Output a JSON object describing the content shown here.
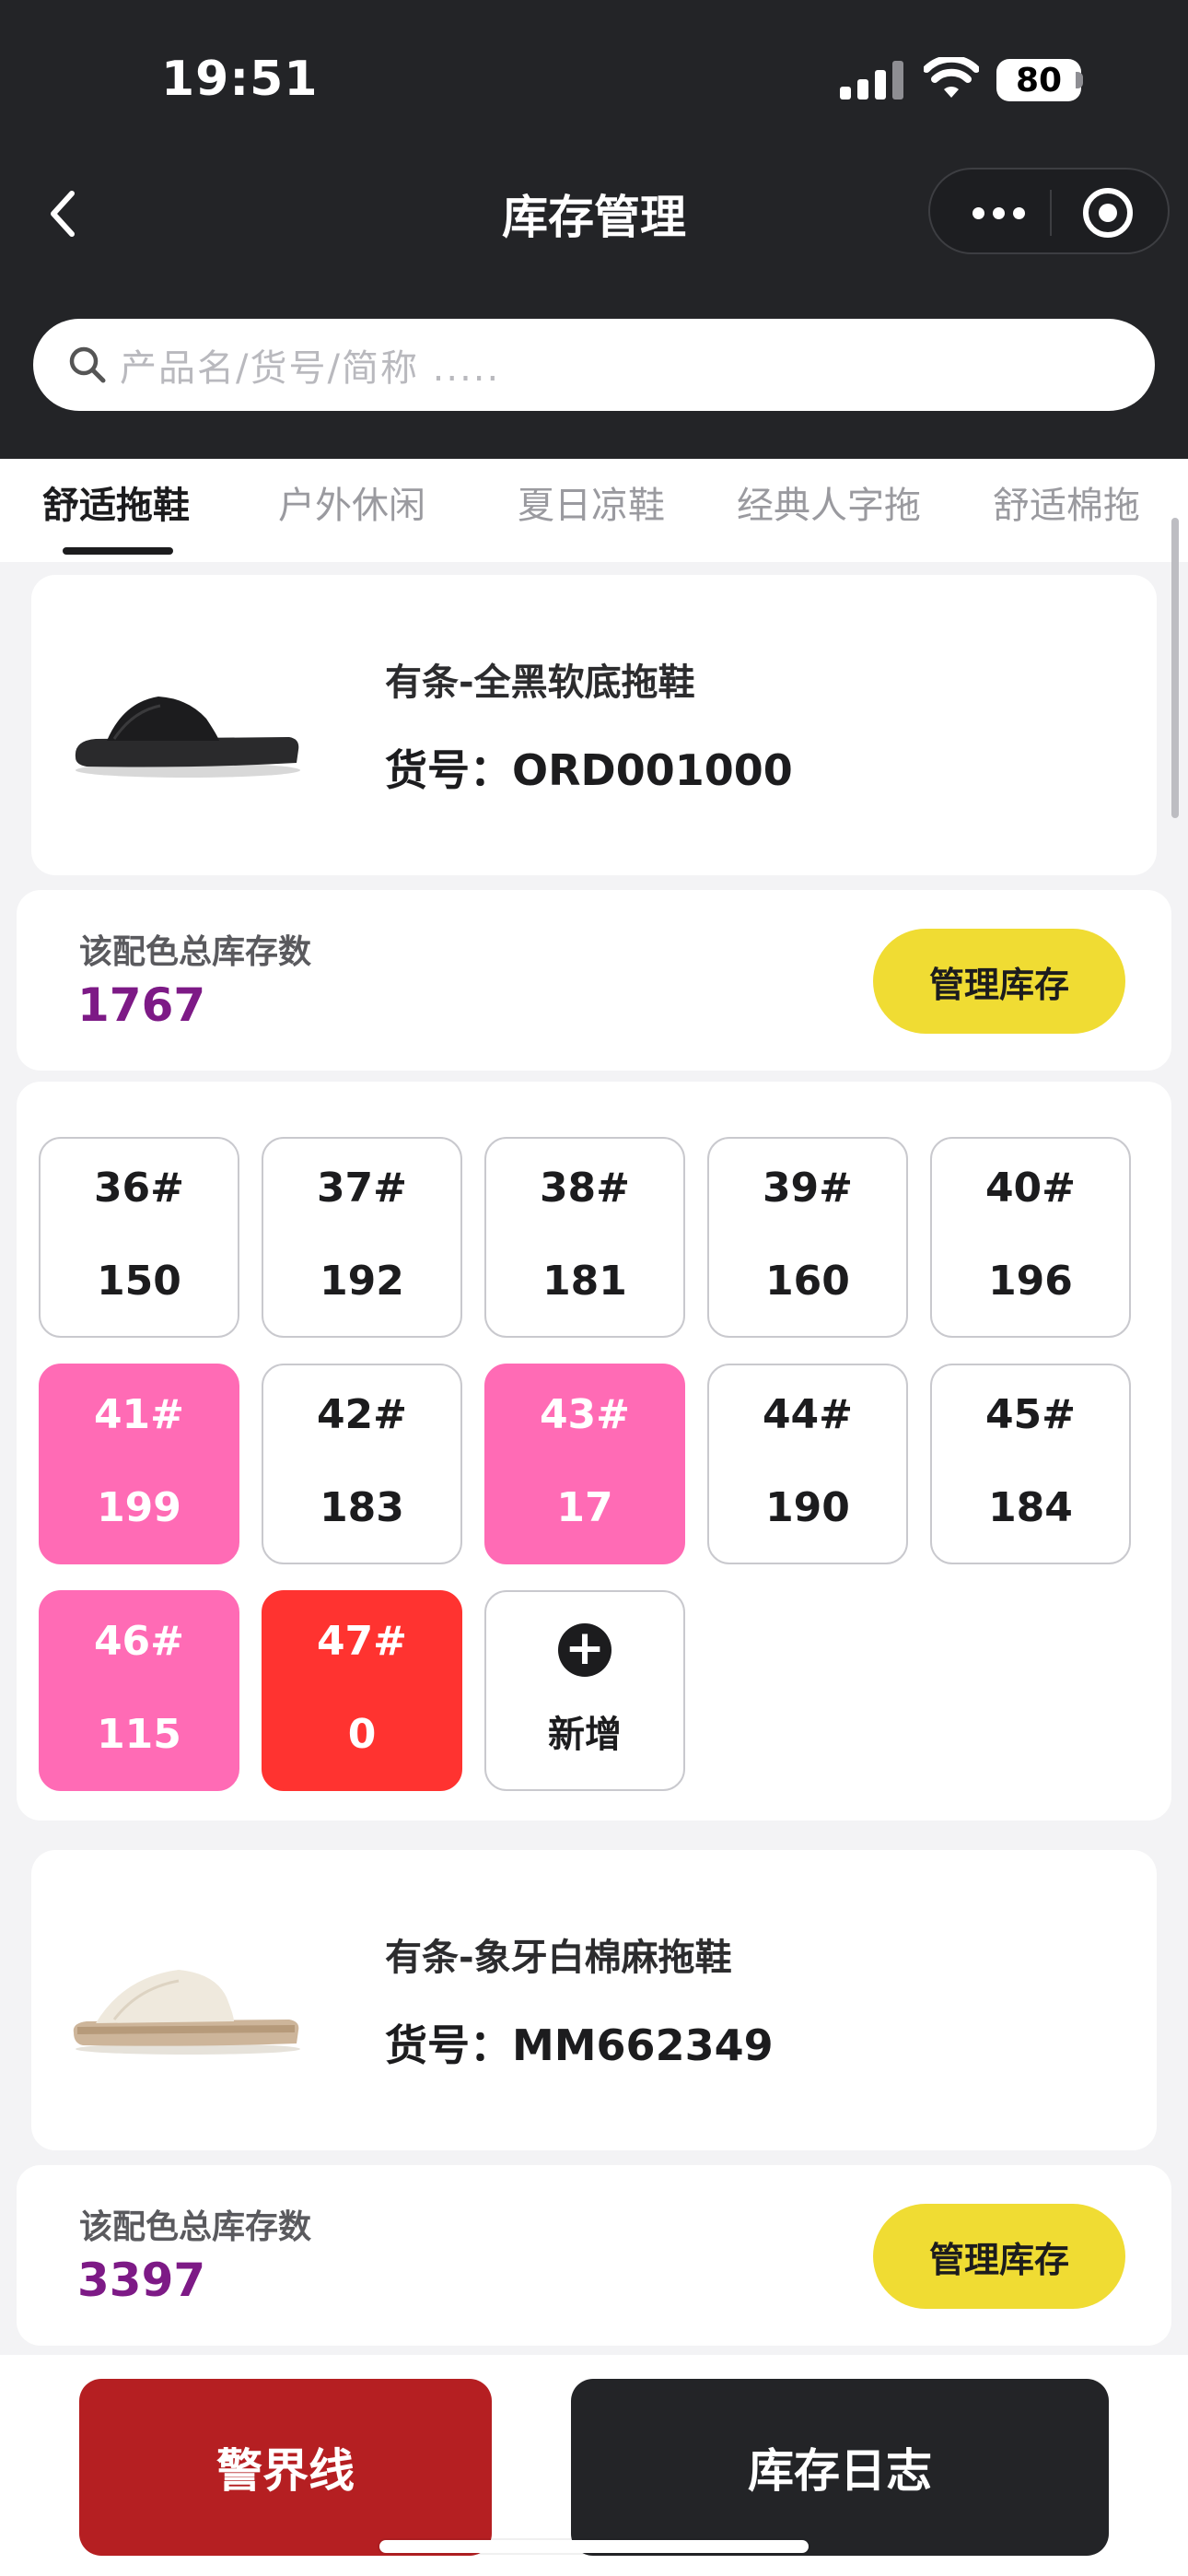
{
  "status_bar": {
    "time": "19:51",
    "battery": "80"
  },
  "nav": {
    "title": "库存管理"
  },
  "search": {
    "placeholder": "产品名/货号/简称 ....."
  },
  "tabs": [
    {
      "label": "舒适拖鞋",
      "active": true
    },
    {
      "label": "户外休闲",
      "active": false
    },
    {
      "label": "夏日凉鞋",
      "active": false
    },
    {
      "label": "经典人字拖",
      "active": false
    },
    {
      "label": "舒适棉拖",
      "active": false
    }
  ],
  "products": [
    {
      "name": "有条-全黑软底拖鞋",
      "code_label": "货号：",
      "code": "ORD001000",
      "code_full": "货号：ORD001000",
      "stock_label": "该配色总库存数",
      "stock_total": "1767",
      "manage_label": "管理库存",
      "image": "black-slipper",
      "sizes": [
        {
          "size": "36#",
          "qty": "150",
          "status": "normal"
        },
        {
          "size": "37#",
          "qty": "192",
          "status": "normal"
        },
        {
          "size": "38#",
          "qty": "181",
          "status": "normal"
        },
        {
          "size": "39#",
          "qty": "160",
          "status": "normal"
        },
        {
          "size": "40#",
          "qty": "196",
          "status": "normal"
        },
        {
          "size": "41#",
          "qty": "199",
          "status": "pink"
        },
        {
          "size": "42#",
          "qty": "183",
          "status": "normal"
        },
        {
          "size": "43#",
          "qty": "17",
          "status": "pink"
        },
        {
          "size": "44#",
          "qty": "190",
          "status": "normal"
        },
        {
          "size": "45#",
          "qty": "184",
          "status": "normal"
        },
        {
          "size": "46#",
          "qty": "115",
          "status": "pink"
        },
        {
          "size": "47#",
          "qty": "0",
          "status": "red"
        }
      ],
      "add_label": "新增"
    },
    {
      "name": "有条-象牙白棉麻拖鞋",
      "code_full": "货号：MM662349",
      "stock_label": "该配色总库存数",
      "stock_total": "3397",
      "manage_label": "管理库存",
      "image": "ivory-slipper"
    }
  ],
  "bottom": {
    "warn_label": "警界线",
    "log_label": "库存日志"
  },
  "colors": {
    "header_bg": "#232427",
    "accent_yellow": "#f0dc33",
    "stock_purple": "#7d1a86",
    "warn_pink": "#ff6bb5",
    "danger_red": "#ff3330",
    "warn_button": "#b51f22"
  }
}
